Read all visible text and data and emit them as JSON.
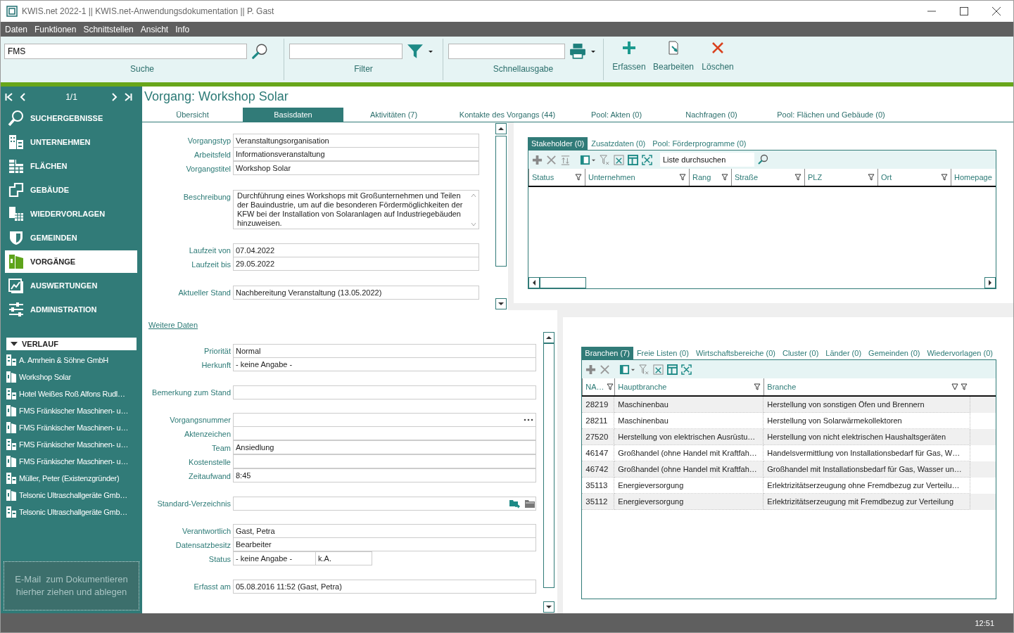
{
  "window": {
    "title": "KWIS.net 2022-1 || KWIS.net-Anwendungsdokumentation || P. Gast"
  },
  "menu": [
    "Daten",
    "Funktionen",
    "Schnittstellen",
    "Ansicht",
    "Info"
  ],
  "ribbon": {
    "search": {
      "value": "FMS",
      "label": "Suche"
    },
    "filter": {
      "label": "Filter"
    },
    "quick_output": {
      "label": "Schnellausgabe"
    },
    "actions": [
      "Erfassen",
      "Bearbeiten",
      "Löschen"
    ]
  },
  "sidebar": {
    "pager": "1/1",
    "nav": [
      {
        "label": "SUCHERGEBNISSE",
        "selected": false
      },
      {
        "label": "UNTERNEHMEN",
        "selected": false
      },
      {
        "label": "FLÄCHEN",
        "selected": false
      },
      {
        "label": "GEBÄUDE",
        "selected": false
      },
      {
        "label": "WIEDERVORLAGEN",
        "selected": false
      },
      {
        "label": "GEMEINDEN",
        "selected": false
      },
      {
        "label": "VORGÄNGE",
        "selected": true
      },
      {
        "label": "AUSWERTUNGEN",
        "selected": false
      },
      {
        "label": "ADMINISTRATION",
        "selected": false
      }
    ],
    "history": {
      "title": "VERLAUF",
      "expanded": true,
      "items": [
        {
          "label": "A. Amrhein & Söhne GmbH",
          "kind": "company"
        },
        {
          "label": "Workshop Solar",
          "kind": "process"
        },
        {
          "label": "Hotel Weißes Roß Alfons Rudl…",
          "kind": "company"
        },
        {
          "label": "FMS Fränkischer Maschinen- u…",
          "kind": "process"
        },
        {
          "label": "FMS Fränkischer Maschinen- u…",
          "kind": "process"
        },
        {
          "label": "FMS Fränkischer Maschinen- u…",
          "kind": "company"
        },
        {
          "label": "FMS Fränkischer Maschinen- u…",
          "kind": "process"
        },
        {
          "label": "Müller, Peter (Existenzgründer)",
          "kind": "company"
        },
        {
          "label": "Telsonic Ultraschallgeräte Gmb…",
          "kind": "process"
        },
        {
          "label": "Telsonic Ultraschallgeräte Gmb…",
          "kind": "company"
        }
      ]
    },
    "dropzone": "E-Mail  zum Dokumentieren hierher ziehen und ablegen"
  },
  "record": {
    "title": "Vorgang: Workshop Solar",
    "tabs": [
      {
        "label": "Übersicht",
        "selected": false
      },
      {
        "label": "Basisdaten",
        "selected": true
      },
      {
        "label": "Aktivitäten (7)",
        "selected": false
      },
      {
        "label": "Kontakte des Vorgangs (44)",
        "selected": false
      },
      {
        "label": "Pool: Akten (0)",
        "selected": false
      },
      {
        "label": "Nachfragen (0)",
        "selected": false
      },
      {
        "label": "Pool: Flächen und Gebäude (0)",
        "selected": false
      }
    ]
  },
  "form_top": {
    "groups": [
      {
        "fields": [
          {
            "label": "Vorgangstyp",
            "value": "Veranstaltungsorganisation",
            "kind": "text"
          },
          {
            "label": "Arbeitsfeld",
            "value": "Informationsveranstaltung",
            "kind": "text"
          },
          {
            "label": "Vorgangstitel",
            "value": "Workshop Solar",
            "kind": "text"
          }
        ]
      },
      {
        "fields": [
          {
            "label": "Beschreibung",
            "value": "Durchführung eines Workshops mit Großunternehmen und Teilen der Bauindustrie, um auf die besonderen Fördermöglichkeiten der KFW bei der Installation von Solaranlagen auf Industriegebäuden hinzuweisen.",
            "kind": "textarea"
          }
        ]
      },
      {
        "fields": [
          {
            "label": "Laufzeit von",
            "value": "07.04.2022",
            "kind": "text"
          },
          {
            "label": "Laufzeit bis",
            "value": "29.05.2022",
            "kind": "text"
          }
        ]
      },
      {
        "fields": [
          {
            "label": "Aktueller Stand",
            "value": "Nachbereitung Veranstaltung (13.05.2022)",
            "kind": "text"
          }
        ]
      }
    ]
  },
  "form_bottom": {
    "link": "Weitere Daten",
    "groups": [
      {
        "fields": [
          {
            "label": "Priorität",
            "value": "Normal",
            "kind": "text"
          },
          {
            "label": "Herkunft",
            "value": "- keine Angabe -",
            "kind": "text"
          }
        ]
      },
      {
        "fields": [
          {
            "label": "Bemerkung zum Stand",
            "kind": "text"
          }
        ]
      },
      {
        "fields": [
          {
            "label": "Vorgangsnummer",
            "kind": "ellipsis"
          },
          {
            "label": "Aktenzeichen",
            "kind": "text"
          },
          {
            "label": "Team",
            "value": "Ansiedlung",
            "kind": "text"
          },
          {
            "label": "Kostenstelle",
            "kind": "text"
          },
          {
            "label": "Zeitaufwand",
            "value": "8:45",
            "kind": "text"
          }
        ]
      },
      {
        "fields": [
          {
            "label": "Standard-Verzeichnis",
            "kind": "folder"
          }
        ]
      },
      {
        "fields": [
          {
            "label": "Verantwortlich",
            "value": "Gast, Petra",
            "kind": "text"
          },
          {
            "label": "Datensatzbesitz",
            "value": "Bearbeiter",
            "kind": "text"
          },
          {
            "label": "Status",
            "value": "- keine Angabe -",
            "value_2": "k.A.",
            "kind": "split"
          }
        ]
      },
      {
        "fields": [
          {
            "label": "Erfasst am",
            "value": "05.08.2016 11:52 (Gast, Petra)",
            "kind": "text"
          }
        ]
      }
    ]
  },
  "stakeholder_panel": {
    "tabs": [
      {
        "label": "Stakeholder (0)",
        "selected": true
      },
      {
        "label": "Zusatzdaten (0)",
        "selected": false
      },
      {
        "label": "Pool: Förderprogramme (0)",
        "selected": false
      }
    ],
    "search_placeholder": "Liste durchsuchen",
    "columns": [
      "Status",
      "Unternehmen",
      "Rang",
      "Straße",
      "PLZ",
      "Ort",
      "Homepage"
    ]
  },
  "branch_panel": {
    "tabs": [
      {
        "label": "Branchen (7)",
        "selected": true
      },
      {
        "label": "Freie Listen (0)",
        "selected": false
      },
      {
        "label": "Wirtschaftsbereiche (0)",
        "selected": false
      },
      {
        "label": "Cluster (0)",
        "selected": false
      },
      {
        "label": "Länder (0)",
        "selected": false
      },
      {
        "label": "Gemeinden (0)",
        "selected": false
      },
      {
        "label": "Wiedervorlagen (0)",
        "selected": false
      }
    ],
    "columns": [
      "NA…",
      "Hauptbranche",
      "Branche"
    ],
    "rows": [
      [
        "28219",
        "Maschinenbau",
        "Herstellung von sonstigen Öfen und Brennern"
      ],
      [
        "28211",
        "Maschinenbau",
        "Herstellung von Solarwärmekollektoren"
      ],
      [
        "27520",
        "Herstellung von elektrischen Ausrüstu…",
        "Herstellung von nicht elektrischen Haushaltsgeräten"
      ],
      [
        "46147",
        "Großhandel (ohne Handel mit Kraftfah…",
        "Handelsvermittlung von Installationsbedarf für Gas, W…"
      ],
      [
        "46742",
        "Großhandel (ohne Handel mit Kraftfah…",
        "Großhandel mit Installationsbedarf für Gas, Wasser un…"
      ],
      [
        "35113",
        "Energieversorgung",
        "Erlektrizitätserzeugung ohne Fremdbezug zur Verteilu…"
      ],
      [
        "35112",
        "Energieversorgung",
        "Erlektrizitätserzeugung mit Fremdbezug zur Verteilung"
      ]
    ]
  },
  "status_bar": {
    "time": "12:51"
  }
}
